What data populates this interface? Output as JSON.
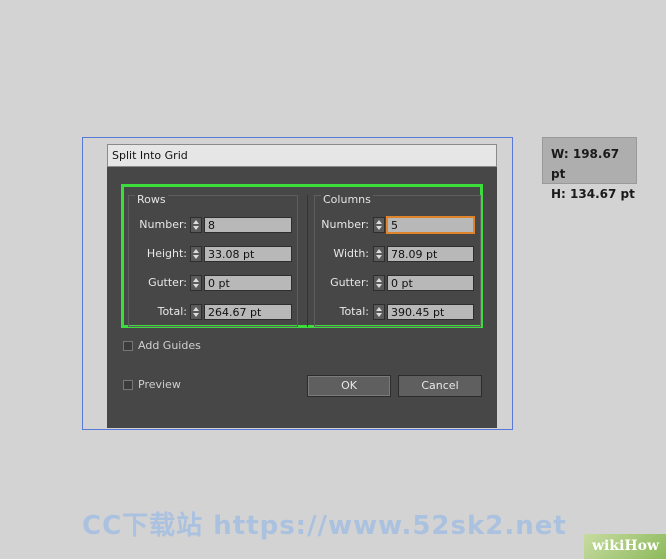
{
  "dialog": {
    "title": "Split Into Grid",
    "rows": {
      "heading": "Rows",
      "fields": [
        {
          "label": "Number:",
          "value": "8"
        },
        {
          "label": "Height:",
          "value": "33.08 pt"
        },
        {
          "label": "Gutter:",
          "value": "0 pt"
        },
        {
          "label": "Total:",
          "value": "264.67 pt"
        }
      ]
    },
    "columns": {
      "heading": "Columns",
      "fields": [
        {
          "label": "Number:",
          "value": "5"
        },
        {
          "label": "Width:",
          "value": "78.09 pt"
        },
        {
          "label": "Gutter:",
          "value": "0 pt"
        },
        {
          "label": "Total:",
          "value": "390.45 pt"
        }
      ]
    },
    "add_guides_label": "Add Guides",
    "preview_label": "Preview",
    "ok_label": "OK",
    "cancel_label": "Cancel"
  },
  "tooltip": {
    "width": "W: 198.67 pt",
    "height": "H: 134.67 pt"
  },
  "watermark": {
    "text": "CC下载站 https://www.52sk2.net"
  },
  "brand": {
    "wiki": "wiki",
    "how": "How"
  },
  "colors": {
    "highlight_box": "#3bdc3b",
    "selection_frame": "#5a78d8",
    "focus_ring": "#e0842c"
  }
}
